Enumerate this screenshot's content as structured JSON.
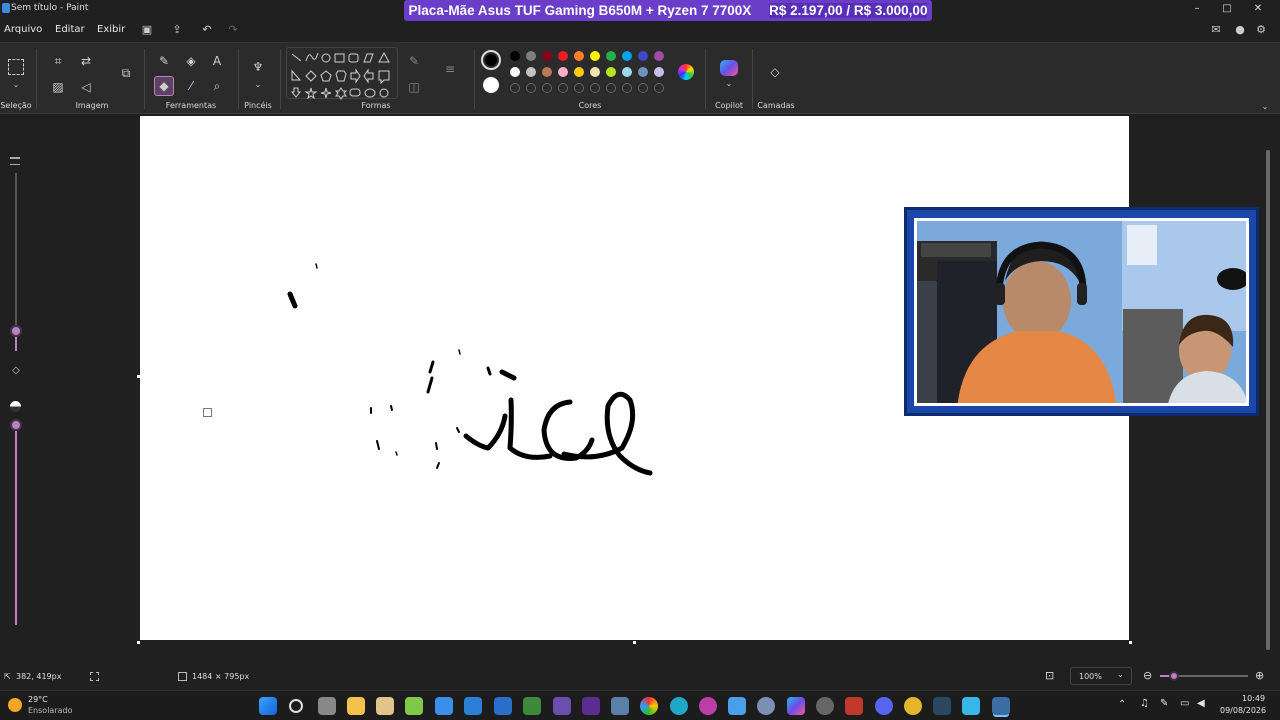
{
  "window": {
    "title": "Sem título - Paint",
    "minimize": "–",
    "maximize": "□",
    "close": "✕"
  },
  "banner": {
    "product": "Placa-Mãe Asus TUF Gaming B650M + Ryzen 7 7700X",
    "price": "R$ 2.197,00 / R$ 3.000,00"
  },
  "menu": {
    "items": [
      "Arquivo",
      "Editar",
      "Exibir"
    ]
  },
  "ribbon": {
    "groups": {
      "selection": "Seleção",
      "image": "Imagem",
      "tools": "Ferramentas",
      "brushes": "Pincéis",
      "shapes": "Formas",
      "colors": "Cores",
      "copilot": "Copilot",
      "layers": "Camadas"
    },
    "palette_row1": [
      "#000000",
      "#7f7f7f",
      "#880015",
      "#ed1c24",
      "#ff7f27",
      "#fff200",
      "#22b14c",
      "#00a2e8",
      "#3f48cc",
      "#a349a4"
    ],
    "palette_row2": [
      "#ffffff",
      "#c3c3c3",
      "#b97a57",
      "#ffaec9",
      "#ffc90e",
      "#efe4b0",
      "#b5e61d",
      "#99d9ea",
      "#7092be",
      "#c8bfe7"
    ],
    "primary_color": "#000000",
    "secondary_color": "#ffffff"
  },
  "status": {
    "cursor_pos": "382, 419px",
    "canvas_size": "1484 × 795px",
    "zoom": "100%"
  },
  "taskbar": {
    "weather_temp": "29°C",
    "weather_desc": "Ensolarado",
    "time": "10:49",
    "date": "09/08/2026"
  }
}
